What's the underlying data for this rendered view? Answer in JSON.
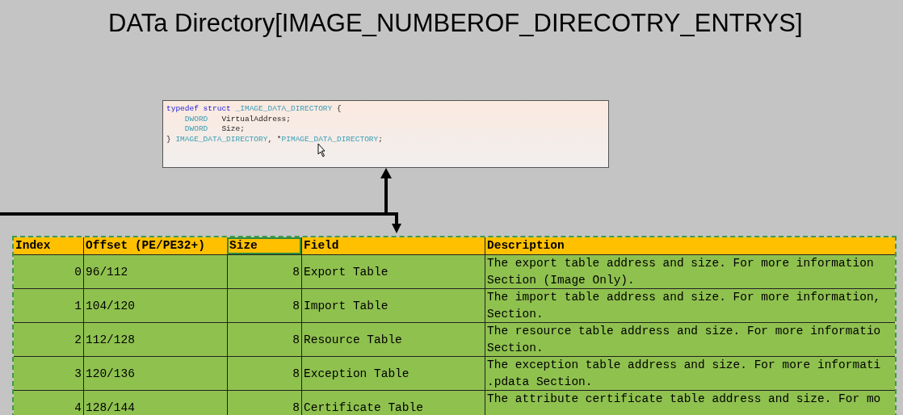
{
  "title": "DATa Directory[IMAGE_NUMBEROF_DIRECOTRY_ENTRYS]",
  "code_box": {
    "lines": [
      [
        {
          "text": "typedef struct",
          "kind": "keyword"
        },
        {
          "text": " _IMAGE_DATA_DIRECTORY",
          "kind": "type"
        },
        {
          "text": " {",
          "kind": "plain"
        }
      ],
      [
        {
          "text": "    DWORD",
          "kind": "type"
        },
        {
          "text": "   VirtualAddress;",
          "kind": "plain"
        }
      ],
      [
        {
          "text": "    DWORD",
          "kind": "type"
        },
        {
          "text": "   Size;",
          "kind": "plain"
        }
      ],
      [
        {
          "text": "} ",
          "kind": "plain"
        },
        {
          "text": "IMAGE_DATA_DIRECTORY",
          "kind": "type"
        },
        {
          "text": ", *",
          "kind": "plain"
        },
        {
          "text": "PIMAGE_DATA_DIRECTORY",
          "kind": "type"
        },
        {
          "text": ";",
          "kind": "plain"
        }
      ]
    ]
  },
  "table": {
    "columns": [
      {
        "label": "Index",
        "selected": false
      },
      {
        "label": "Offset (PE/PE32+)",
        "selected": false
      },
      {
        "label": "Size",
        "selected": true
      },
      {
        "label": "Field",
        "selected": false
      },
      {
        "label": "Description",
        "selected": false
      }
    ],
    "rows": [
      {
        "index": "0",
        "offset": "96/112",
        "size": "8",
        "field": "Export Table",
        "description": "The export table address and size. For more information\nSection (Image Only)."
      },
      {
        "index": "1",
        "offset": "104/120",
        "size": "8",
        "field": "Import Table",
        "description": "The import table address and size. For more information,\nSection."
      },
      {
        "index": "2",
        "offset": "112/128",
        "size": "8",
        "field": "Resource Table",
        "description": "The resource table address and size. For more informatio\nSection."
      },
      {
        "index": "3",
        "offset": "120/136",
        "size": "8",
        "field": "Exception Table",
        "description": "The exception table address and size. For more informati\n.pdata Section."
      },
      {
        "index": "4",
        "offset": "128/144",
        "size": "8",
        "field": "Certificate Table",
        "description": "The attribute certificate table address and size. For mo"
      }
    ]
  }
}
